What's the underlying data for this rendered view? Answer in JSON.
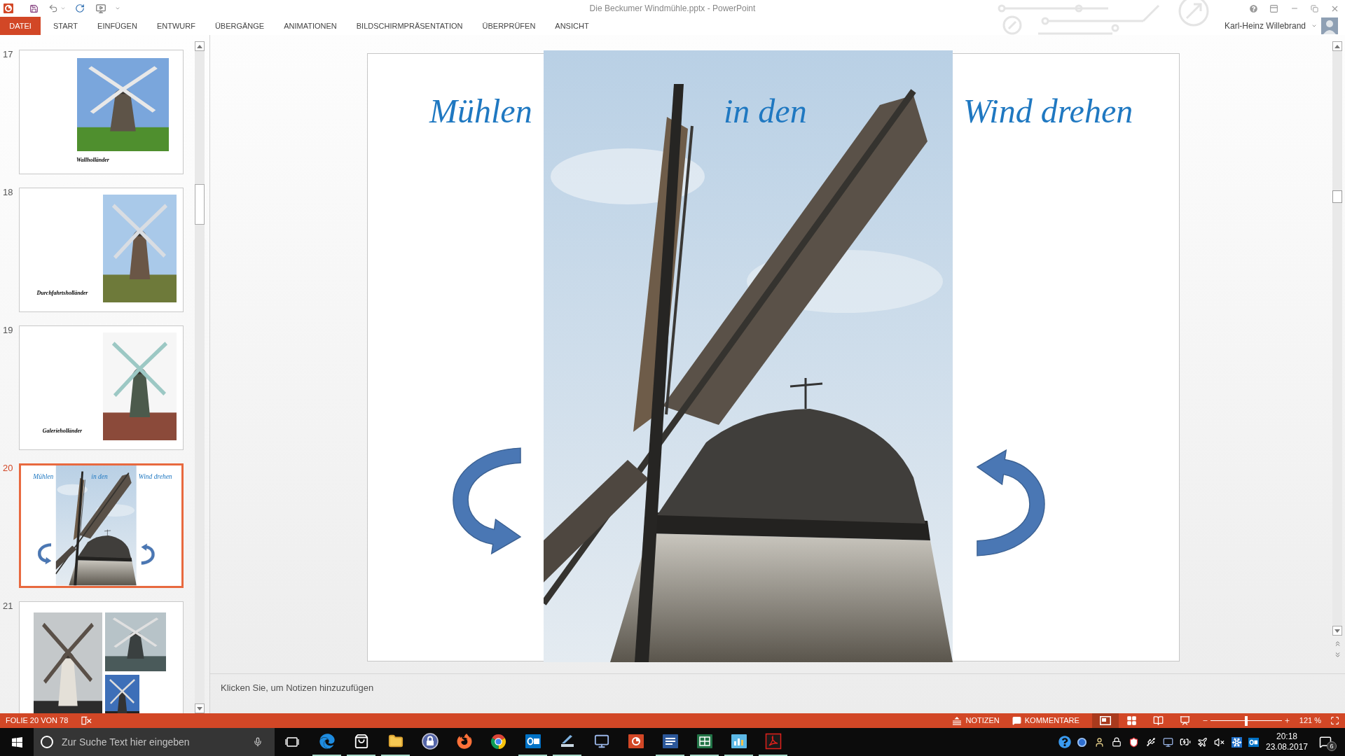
{
  "window": {
    "title": "Die Beckumer Windmühle.pptx - PowerPoint"
  },
  "ribbon_tabs": [
    {
      "label": "DATEI",
      "kind": "file",
      "selected": false
    },
    {
      "label": "START",
      "kind": "tab",
      "selected": false
    },
    {
      "label": "EINFÜGEN",
      "kind": "tab",
      "selected": false
    },
    {
      "label": "ENTWURF",
      "kind": "tab",
      "selected": false
    },
    {
      "label": "ÜBERGÄNGE",
      "kind": "tab",
      "selected": false
    },
    {
      "label": "ANIMATIONEN",
      "kind": "tab",
      "selected": false
    },
    {
      "label": "BILDSCHIRMPRÄSENTATION",
      "kind": "tab",
      "selected": false
    },
    {
      "label": "ÜBERPRÜFEN",
      "kind": "tab",
      "selected": false
    },
    {
      "label": "ANSICHT",
      "kind": "tab",
      "selected": false
    }
  ],
  "account": {
    "name": "Karl-Heinz Willebrand"
  },
  "slides": [
    {
      "number": "17",
      "kind": "photo_caption",
      "selected": false,
      "caption": "Wallholländer"
    },
    {
      "number": "18",
      "kind": "caption_photo",
      "selected": false,
      "caption": "Durchfahrtsholländer"
    },
    {
      "number": "19",
      "kind": "caption_photo",
      "selected": false,
      "caption": "Galerieholländer"
    },
    {
      "number": "20",
      "kind": "title_arrows",
      "selected": true,
      "texts": [
        "Mühlen",
        "in den",
        "Wind drehen"
      ]
    },
    {
      "number": "21",
      "kind": "three_photos",
      "selected": false
    }
  ],
  "editor": {
    "texts": [
      "Mühlen",
      "in den",
      "Wind drehen"
    ]
  },
  "notes": {
    "placeholder": "Klicken Sie, um Notizen hinzuzufügen"
  },
  "status_bar": {
    "slide_info": "FOLIE 20 VON 78",
    "notes_button": "NOTIZEN",
    "comments_button": "KOMMENTARE",
    "views": [
      {
        "kind": "normal",
        "selected": true
      },
      {
        "kind": "sorter",
        "selected": false
      },
      {
        "kind": "reading",
        "selected": false
      },
      {
        "kind": "slideshow",
        "selected": false
      }
    ],
    "zoom": {
      "level": 0.5,
      "reading": "121 %"
    }
  },
  "taskbar": {
    "search": {
      "placeholder": "Zur Suche Text hier eingeben"
    },
    "apps": [
      {
        "kind": "edge",
        "running": true
      },
      {
        "kind": "store",
        "running": true
      },
      {
        "kind": "explorer",
        "running": true
      },
      {
        "kind": "keepass",
        "running": false
      },
      {
        "kind": "firefox",
        "running": false
      },
      {
        "kind": "chrome",
        "running": false
      },
      {
        "kind": "outlook",
        "running": true
      },
      {
        "kind": "scanner",
        "running": true
      },
      {
        "kind": "network",
        "running": false
      },
      {
        "kind": "powerpoint",
        "running": false
      },
      {
        "kind": "word",
        "running": true
      },
      {
        "kind": "excel",
        "running": true
      },
      {
        "kind": "chart",
        "running": true
      },
      {
        "kind": "acrobat",
        "running": true
      }
    ],
    "clock": {
      "time": "20:18",
      "date": "23.08.2017"
    },
    "notifications": "6"
  }
}
